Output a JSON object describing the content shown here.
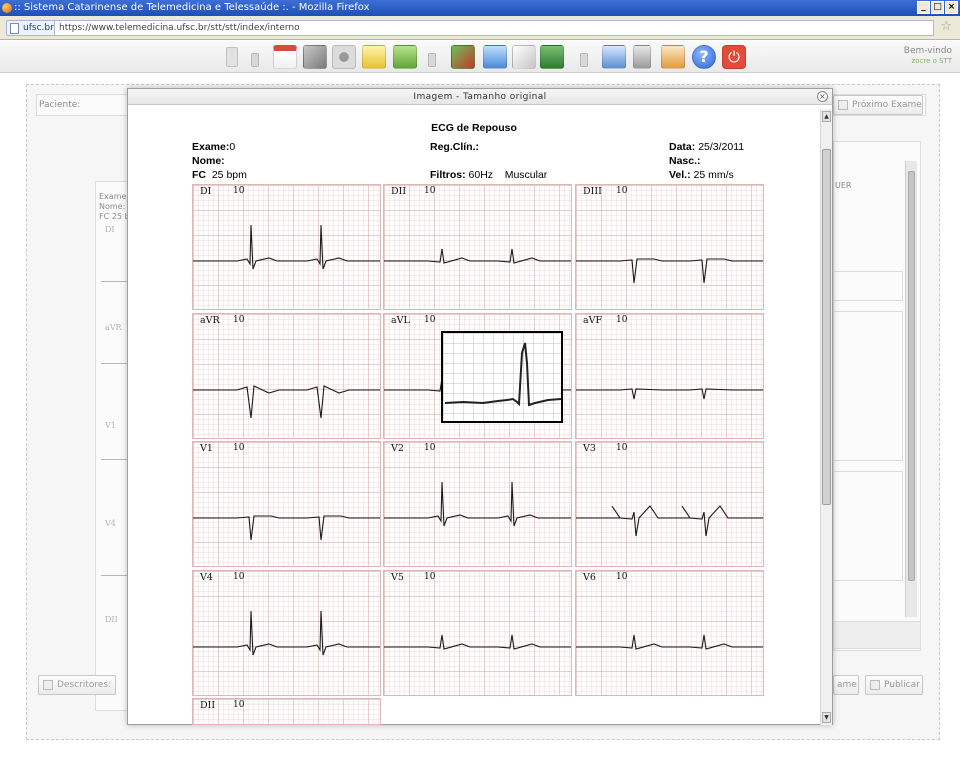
{
  "browser": {
    "window_title": ":: Sistema Catarinense de Telemedicina e Telessaúde :. - Mozilla Firefox",
    "site_badge": "ufsc.br",
    "url": "https://www.telemedicina.ufsc.br/stt/stt/index/interno",
    "window_buttons": [
      "_",
      "□",
      "×"
    ]
  },
  "app_toolbar": {
    "welcome": "Bem-vindo",
    "user": "zocre o STT",
    "icons": [
      "document-icon",
      "separator",
      "calendar-icon",
      "tools-icon",
      "users-icon",
      "monitor-icon",
      "group-icon",
      "separator",
      "chart-icon",
      "clipboard-icon",
      "notes-icon",
      "person-icon",
      "separator",
      "archive-icon",
      "lock-icon",
      "report-icon",
      "help-icon",
      "power-icon"
    ]
  },
  "background": {
    "patient_label": "Paciente:",
    "next_exam_button": "Próximo Exame",
    "descriptors_button": "Descritores:",
    "exam_button": "ame",
    "publish_button": "Publicar",
    "side_text": "UER",
    "exam_short": "Exame:",
    "name_short": "Nome:",
    "fc_short": "FC  25 b",
    "leads": [
      "DI",
      "aVR",
      "V1",
      "V4",
      "DII"
    ]
  },
  "modal": {
    "title": "Imagem - Tamanho original",
    "close_icon": "×"
  },
  "ecg": {
    "title": "ECG de Repouso",
    "exam_label": "Exame:",
    "exam_value": "0",
    "name_label": "Nome:",
    "fc_label": "FC",
    "fc_value": "25 bpm",
    "reg_label": "Reg.Clín.:",
    "filters_label": "Filtros:",
    "filters_value": "60Hz",
    "filter_mode": "Muscular",
    "date_label": "Data:",
    "date_value": "25/3/2011",
    "birth_label": "Nasc.:",
    "speed_label": "Vel.:",
    "speed_value": "25 mm/s",
    "leads": [
      {
        "name": "DI",
        "gain": "10"
      },
      {
        "name": "DII",
        "gain": "10"
      },
      {
        "name": "DIII",
        "gain": "10"
      },
      {
        "name": "aVR",
        "gain": "10"
      },
      {
        "name": "aVL",
        "gain": "10"
      },
      {
        "name": "aVF",
        "gain": "10"
      },
      {
        "name": "V1",
        "gain": "10"
      },
      {
        "name": "V2",
        "gain": "10"
      },
      {
        "name": "V3",
        "gain": "10"
      },
      {
        "name": "V4",
        "gain": "10"
      },
      {
        "name": "V5",
        "gain": "10"
      },
      {
        "name": "V6",
        "gain": "10"
      },
      {
        "name": "DII",
        "gain": "10"
      }
    ]
  }
}
